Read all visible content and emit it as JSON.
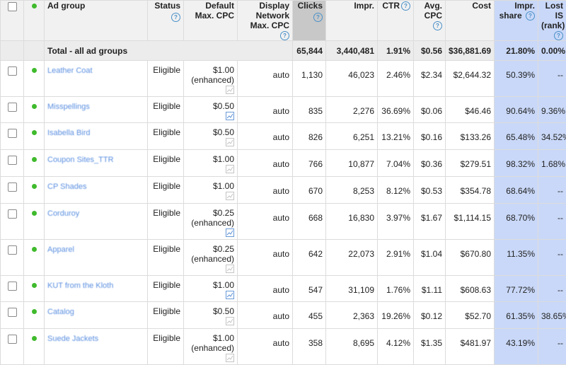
{
  "headers": {
    "ad_group": "Ad group",
    "status": "Status",
    "default_cpc": "Default Max. CPC",
    "display_cpc": "Display Network Max. CPC",
    "clicks": "Clicks",
    "impr": "Impr.",
    "ctr": "CTR",
    "avg_cpc": "Avg. CPC",
    "cost": "Cost",
    "impr_share": "Impr. share",
    "lost_is": "Lost IS (rank)"
  },
  "total": {
    "label": "Total - all ad groups",
    "clicks": "65,844",
    "impr": "3,440,481",
    "ctr": "1.91%",
    "avg_cpc": "$0.56",
    "cost": "$36,881.69",
    "impr_share": "21.80%",
    "lost_is": "0.00%"
  },
  "rows": [
    {
      "name": "Leather Coat",
      "status": "Eligible",
      "bid": "$1.00",
      "enhanced": "(enhanced)",
      "trend_active": false,
      "display": "auto",
      "clicks": "1,130",
      "impr": "46,023",
      "ctr": "2.46%",
      "avg_cpc": "$2.34",
      "cost": "$2,644.32",
      "impr_share": "50.39%",
      "lost_is": "--"
    },
    {
      "name": "Misspellings",
      "status": "Eligible",
      "bid": "$0.50",
      "enhanced": "",
      "trend_active": true,
      "display": "auto",
      "clicks": "835",
      "impr": "2,276",
      "ctr": "36.69%",
      "avg_cpc": "$0.06",
      "cost": "$46.46",
      "impr_share": "90.64%",
      "lost_is": "9.36%"
    },
    {
      "name": "Isabella Bird",
      "status": "Eligible",
      "bid": "$0.50",
      "enhanced": "",
      "trend_active": false,
      "display": "auto",
      "clicks": "826",
      "impr": "6,251",
      "ctr": "13.21%",
      "avg_cpc": "$0.16",
      "cost": "$133.26",
      "impr_share": "65.48%",
      "lost_is": "34.52%"
    },
    {
      "name": "Coupon Sites_TTR",
      "status": "Eligible",
      "bid": "$1.00",
      "enhanced": "",
      "trend_active": false,
      "display": "auto",
      "clicks": "766",
      "impr": "10,877",
      "ctr": "7.04%",
      "avg_cpc": "$0.36",
      "cost": "$279.51",
      "impr_share": "98.32%",
      "lost_is": "1.68%"
    },
    {
      "name": "CP Shades",
      "status": "Eligible",
      "bid": "$1.00",
      "enhanced": "",
      "trend_active": false,
      "display": "auto",
      "clicks": "670",
      "impr": "8,253",
      "ctr": "8.12%",
      "avg_cpc": "$0.53",
      "cost": "$354.78",
      "impr_share": "68.64%",
      "lost_is": "--"
    },
    {
      "name": "Corduroy",
      "status": "Eligible",
      "bid": "$0.25",
      "enhanced": "(enhanced)",
      "trend_active": true,
      "display": "auto",
      "clicks": "668",
      "impr": "16,830",
      "ctr": "3.97%",
      "avg_cpc": "$1.67",
      "cost": "$1,114.15",
      "impr_share": "68.70%",
      "lost_is": "--"
    },
    {
      "name": "Apparel",
      "status": "Eligible",
      "bid": "$0.25",
      "enhanced": "(enhanced)",
      "trend_active": false,
      "display": "auto",
      "clicks": "642",
      "impr": "22,073",
      "ctr": "2.91%",
      "avg_cpc": "$1.04",
      "cost": "$670.80",
      "impr_share": "11.35%",
      "lost_is": "--"
    },
    {
      "name": "KUT from the Kloth",
      "status": "Eligible",
      "bid": "$1.00",
      "enhanced": "",
      "trend_active": true,
      "display": "auto",
      "clicks": "547",
      "impr": "31,109",
      "ctr": "1.76%",
      "avg_cpc": "$1.11",
      "cost": "$608.63",
      "impr_share": "77.72%",
      "lost_is": "--"
    },
    {
      "name": "Catalog",
      "status": "Eligible",
      "bid": "$0.50",
      "enhanced": "",
      "trend_active": false,
      "display": "auto",
      "clicks": "455",
      "impr": "2,363",
      "ctr": "19.26%",
      "avg_cpc": "$0.12",
      "cost": "$52.70",
      "impr_share": "61.35%",
      "lost_is": "38.65%"
    },
    {
      "name": "Suede Jackets",
      "status": "Eligible",
      "bid": "$1.00",
      "enhanced": "(enhanced)",
      "trend_active": false,
      "display": "auto",
      "clicks": "358",
      "impr": "8,695",
      "ctr": "4.12%",
      "avg_cpc": "$1.35",
      "cost": "$481.97",
      "impr_share": "43.19%",
      "lost_is": "--"
    }
  ],
  "colors": {
    "status_dot": "#3fba2c",
    "highlight_column": "#c9d8f8",
    "sorted_column": "#c8c8c8",
    "link": "#5b8fe0"
  },
  "icons": {
    "help": "help-circle-icon",
    "trend": "trend-chart-icon",
    "status": "status-dot-icon"
  }
}
